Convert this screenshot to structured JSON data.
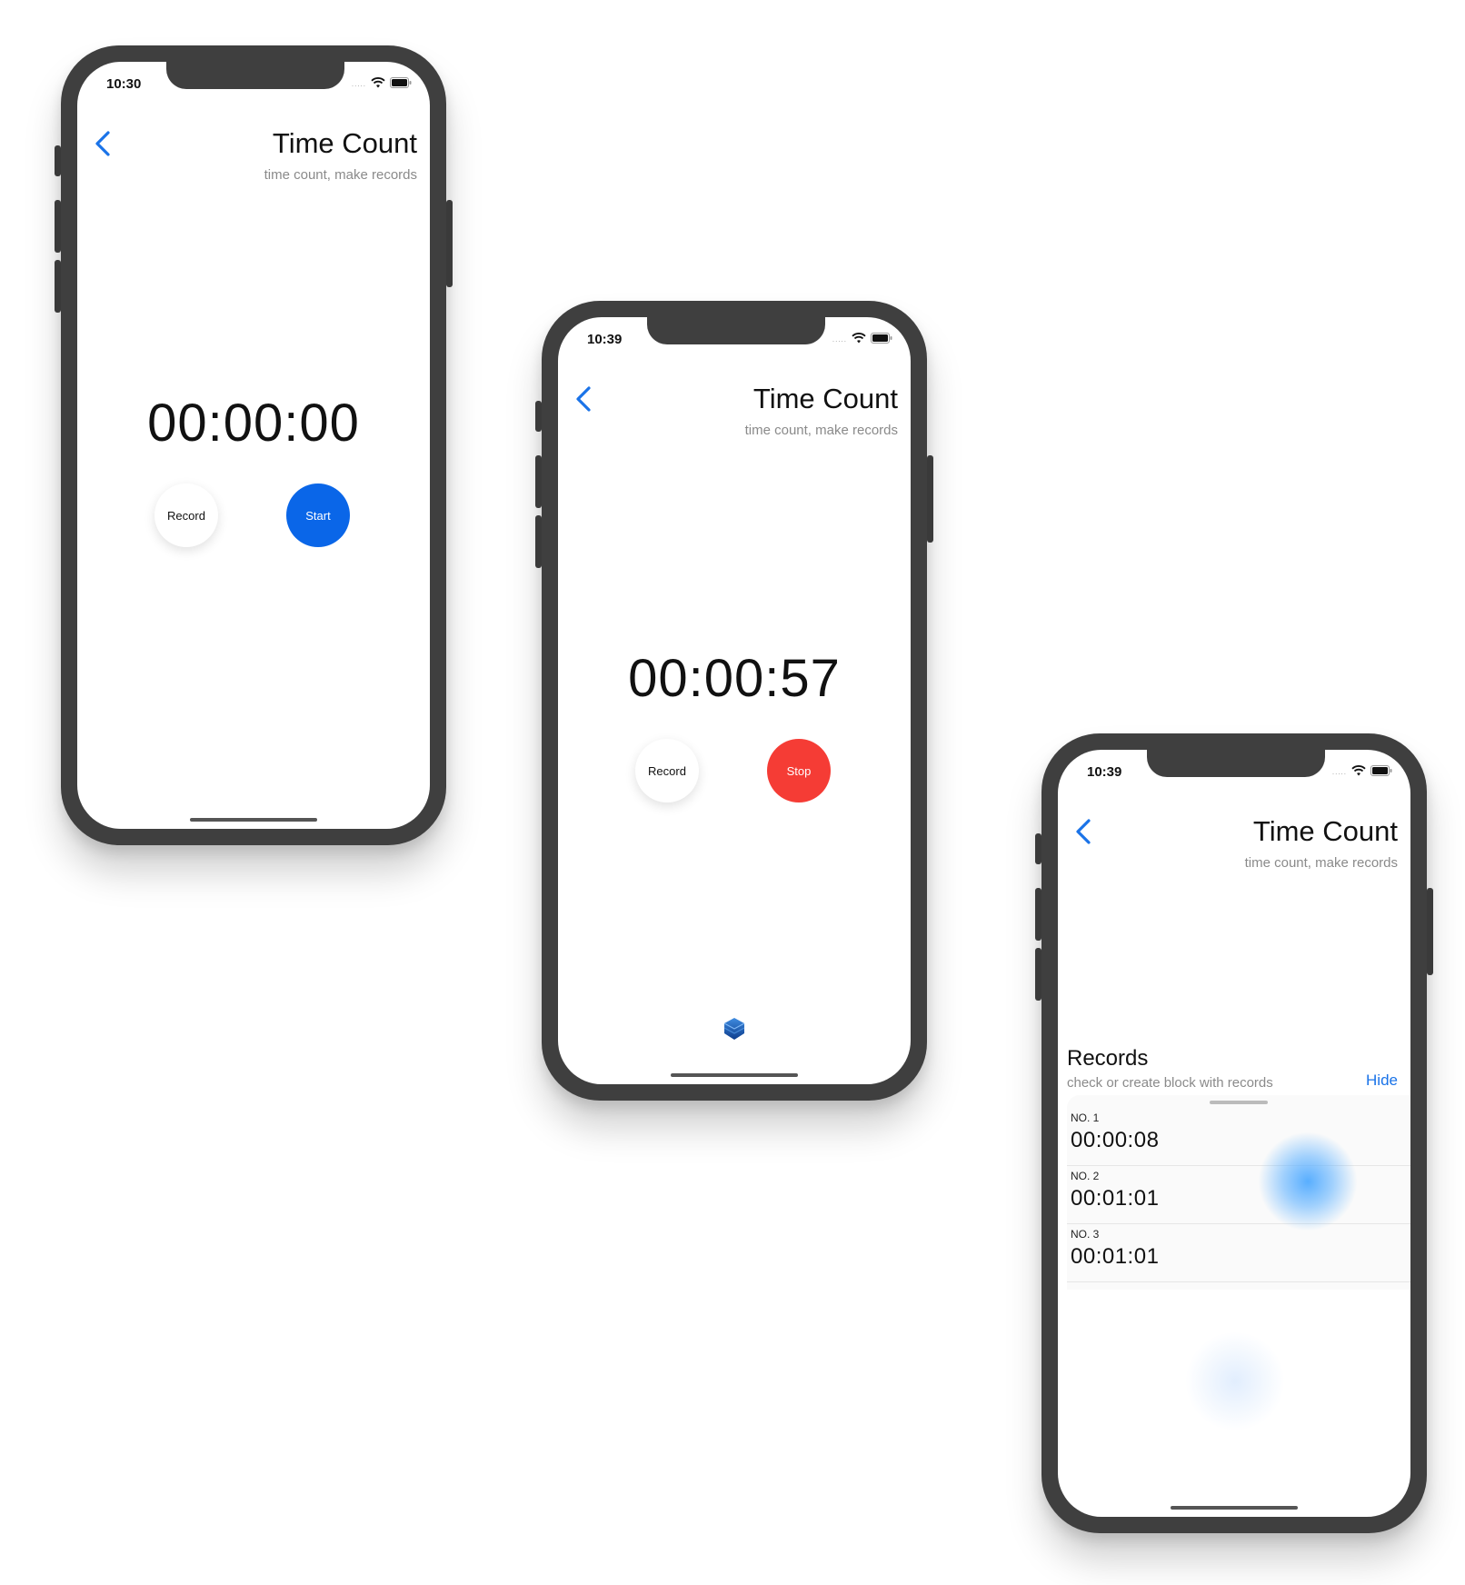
{
  "colors": {
    "accent": "#1a73e8",
    "start": "#0a66e8",
    "stop": "#f53c35",
    "frame": "#3f3f3f"
  },
  "screens": [
    {
      "status": {
        "time": "10:30",
        "signal": "....."
      },
      "header": {
        "title": "Time Count",
        "subtitle": "time count, make records"
      },
      "timer": "00:00:00",
      "record_label": "Record",
      "action_label": "Start",
      "action_state": "start"
    },
    {
      "status": {
        "time": "10:39",
        "signal": "....."
      },
      "header": {
        "title": "Time Count",
        "subtitle": "time count, make records"
      },
      "timer": "00:00:57",
      "record_label": "Record",
      "action_label": "Stop",
      "action_state": "stop",
      "bottom_icon": "layers-icon"
    },
    {
      "status": {
        "time": "10:39",
        "signal": "....."
      },
      "header": {
        "title": "Time Count",
        "subtitle": "time count, make records"
      },
      "records": {
        "title": "Records",
        "subtitle": "check or create block with records",
        "hide_label": "Hide",
        "items": [
          {
            "no": "NO. 1",
            "time": "00:00:08"
          },
          {
            "no": "NO. 2",
            "time": "00:01:01"
          },
          {
            "no": "NO. 3",
            "time": "00:01:01"
          }
        ]
      }
    }
  ]
}
